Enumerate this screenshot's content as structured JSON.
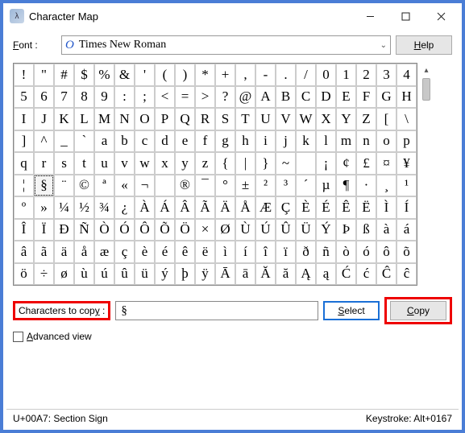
{
  "window": {
    "title": "Character Map"
  },
  "fontRow": {
    "label_prefix": "F",
    "label_suffix": "ont :",
    "fontName": "Times New Roman",
    "help_prefix": "H",
    "help_suffix": "elp"
  },
  "selectedCell": "§",
  "chars": [
    "!",
    "\"",
    "#",
    "$",
    "%",
    "&",
    "'",
    "(",
    ")",
    "*",
    "+",
    ",",
    "-",
    ".",
    "/",
    "0",
    "1",
    "2",
    "3",
    "4",
    "5",
    "6",
    "7",
    "8",
    "9",
    ":",
    ";",
    "<",
    "=",
    ">",
    "?",
    "@",
    "A",
    "B",
    "C",
    "D",
    "E",
    "F",
    "G",
    "H",
    "I",
    "J",
    "K",
    "L",
    "M",
    "N",
    "O",
    "P",
    "Q",
    "R",
    "S",
    "T",
    "U",
    "V",
    "W",
    "X",
    "Y",
    "Z",
    "[",
    "\\",
    "]",
    "^",
    "_",
    "`",
    "a",
    "b",
    "c",
    "d",
    "e",
    "f",
    "g",
    "h",
    "i",
    "j",
    "k",
    "l",
    "m",
    "n",
    "o",
    "p",
    "q",
    "r",
    "s",
    "t",
    "u",
    "v",
    "w",
    "x",
    "y",
    "z",
    "{",
    "|",
    "}",
    "~",
    "",
    "¡",
    "¢",
    "£",
    "¤",
    "¥",
    "¦",
    "§",
    "¨",
    "©",
    "ª",
    "«",
    "¬",
    "­",
    "®",
    "¯",
    "°",
    "±",
    "²",
    "³",
    "´",
    "µ",
    "¶",
    "·",
    "¸",
    "¹",
    "º",
    "»",
    "¼",
    "½",
    "¾",
    "¿",
    "À",
    "Á",
    "Â",
    "Ã",
    "Ä",
    "Å",
    "Æ",
    "Ç",
    "È",
    "É",
    "Ê",
    "Ë",
    "Ì",
    "Í",
    "Î",
    "Ï",
    "Ð",
    "Ñ",
    "Ò",
    "Ó",
    "Ô",
    "Õ",
    "Ö",
    "×",
    "Ø",
    "Ù",
    "Ú",
    "Û",
    "Ü",
    "Ý",
    "Þ",
    "ß",
    "à",
    "á",
    "â",
    "ã",
    "ä",
    "å",
    "æ",
    "ç",
    "è",
    "é",
    "ê",
    "ë",
    "ì",
    "í",
    "î",
    "ï",
    "ð",
    "ñ",
    "ò",
    "ó",
    "ô",
    "õ",
    "ö",
    "÷",
    "ø",
    "ù",
    "ú",
    "û",
    "ü",
    "ý",
    "þ",
    "ÿ",
    "Ā",
    "ā",
    "Ă",
    "ă",
    "Ą",
    "ą",
    "Ć",
    "ć",
    "Ĉ",
    "ĉ"
  ],
  "copyRow": {
    "label_pre": "Characters to cop",
    "label_u": "y",
    "label_post": " :",
    "value": "§",
    "select_u": "S",
    "select_rest": "elect",
    "copy_u": "C",
    "copy_rest": "opy"
  },
  "advanced": {
    "u": "A",
    "rest": "dvanced view"
  },
  "status": {
    "left": "U+00A7: Section Sign",
    "right": "Keystroke: Alt+0167"
  }
}
